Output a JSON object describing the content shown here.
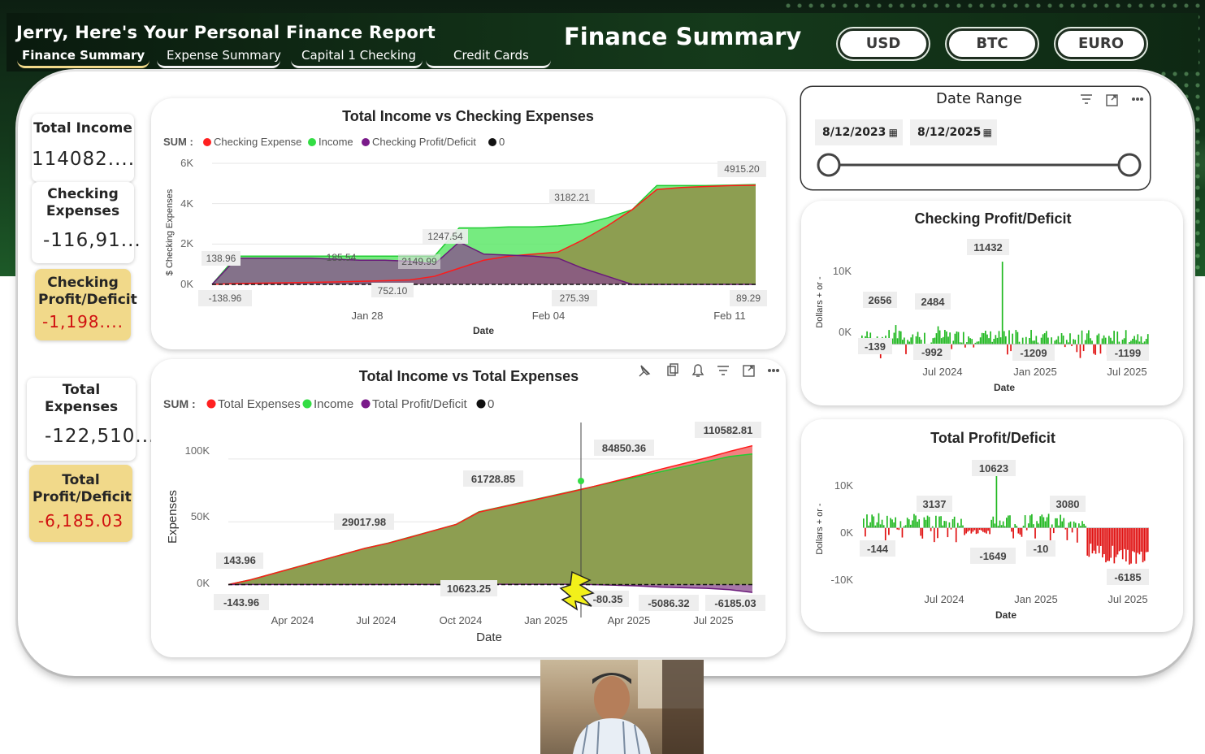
{
  "header": {
    "report_title": "Jerry, Here's Your Personal Finance Report",
    "page_title": "Finance Summary",
    "tabs": [
      {
        "label": "Finance Summary",
        "active": true
      },
      {
        "label": "Expense Summary",
        "active": false
      },
      {
        "label": "Capital 1 Checking",
        "active": false
      },
      {
        "label": "Credit Cards",
        "active": false
      }
    ],
    "currencies": [
      "USD",
      "BTC",
      "EURO"
    ]
  },
  "kpis": {
    "total_income": {
      "label": "Total Income",
      "value": "114082...."
    },
    "checking_expenses": {
      "label": "Checking Expenses",
      "value": "-116,91..."
    },
    "checking_profit": {
      "label": "Checking Profit/Deficit",
      "value": "-1,198...."
    },
    "total_expenses": {
      "label": "Total Expenses",
      "value": "-122,510..."
    },
    "total_profit": {
      "label": "Total Profit/Deficit",
      "value": "-6,185.03"
    }
  },
  "date_range": {
    "title": "Date Range",
    "start": "8/12/2023",
    "end": "8/12/2025"
  },
  "colors": {
    "expense_red": "#ff2020",
    "income_green": "#33dd44",
    "profit_purple": "#7a1a8a",
    "zero_black": "#111111",
    "gold": "#f1d98a",
    "neg_red": "#d01010"
  },
  "chart_data": [
    {
      "id": "checking",
      "type": "area",
      "title": "Total Income vs Checking Expenses",
      "legend_prefix": "SUM :",
      "legend": [
        "Checking Expense",
        "Income",
        "Checking Profit/Deficit",
        "0"
      ],
      "xlabel": "Date",
      "ylabel": "$ Checking Expenses",
      "yticks": [
        "6K",
        "4K",
        "2K",
        "0K"
      ],
      "xticks": [
        "Jan 28",
        "Feb 04",
        "Feb 11"
      ],
      "ylim": [
        0,
        6000
      ],
      "x": [
        0,
        1,
        2,
        3,
        4,
        5,
        6,
        7,
        8,
        9,
        10,
        11,
        12,
        13,
        14,
        15,
        16,
        17,
        18,
        19,
        20,
        21,
        22
      ],
      "series": [
        {
          "name": "Income",
          "values": [
            0,
            1400,
            1400,
            1400,
            1400,
            1400,
            1400,
            1400,
            1400,
            1400,
            2800,
            2800,
            2850,
            2850,
            2900,
            3000,
            3300,
            3700,
            4900,
            4900,
            4900,
            4920,
            4950
          ]
        },
        {
          "name": "Checking Expense",
          "values": [
            0,
            40,
            60,
            80,
            100,
            120,
            150,
            180,
            220,
            400,
            800,
            1200,
            1400,
            1500,
            1600,
            2200,
            2900,
            3700,
            4700,
            4800,
            4850,
            4900,
            4915
          ]
        },
        {
          "name": "Checking Profit/Deficit",
          "values": [
            0,
            1300,
            1300,
            1300,
            1300,
            1250,
            1200,
            1200,
            1150,
            1000,
            2100,
            1500,
            1450,
            1400,
            1300,
            800,
            400,
            0,
            0,
            0,
            0,
            0,
            0
          ]
        }
      ],
      "labels": [
        "138.96",
        "185.54",
        "2149.99",
        "1247.54",
        "3182.21",
        "4915.20",
        "-138.96",
        "752.10",
        "275.39",
        "89.29"
      ]
    },
    {
      "id": "total",
      "type": "area",
      "title": "Total Income vs Total Expenses",
      "legend_prefix": "SUM :",
      "legend": [
        "Total Expenses",
        "Income",
        "Total Profit/Deficit",
        "0"
      ],
      "xlabel": "Date",
      "ylabel": "Expenses",
      "yticks": [
        "100K",
        "50K",
        "0K"
      ],
      "xticks": [
        "Apr 2024",
        "Jul 2024",
        "Oct 2024",
        "Jan 2025",
        "Apr 2025",
        "Jul 2025"
      ],
      "ylim": [
        -10000,
        120000
      ],
      "x": [
        0,
        1,
        2,
        3,
        4,
        5,
        6,
        7,
        8,
        9,
        10,
        11,
        12,
        13,
        14,
        15,
        16,
        17,
        18,
        19,
        20,
        21,
        22,
        23
      ],
      "series": [
        {
          "name": "Income",
          "values": [
            0,
            4000,
            9000,
            14000,
            19000,
            24000,
            29000,
            33000,
            38000,
            43000,
            48000,
            58000,
            62000,
            66000,
            70000,
            74000,
            78000,
            82000,
            86000,
            90000,
            94000,
            98000,
            102000,
            104000
          ]
        },
        {
          "name": "Total Expenses",
          "values": [
            0,
            3900,
            8900,
            13900,
            18900,
            23900,
            28900,
            32900,
            37800,
            42900,
            47900,
            57700,
            61700,
            65700,
            69700,
            73700,
            78000,
            82500,
            87000,
            92000,
            96500,
            101000,
            106000,
            110582
          ]
        },
        {
          "name": "Total Profit/Deficit",
          "values": [
            0,
            100,
            100,
            100,
            100,
            100,
            100,
            100,
            200,
            100,
            100,
            300,
            300,
            300,
            300,
            300,
            0,
            -500,
            -1000,
            -2000,
            -2500,
            -3000,
            -4000,
            -6185
          ]
        }
      ],
      "labels": [
        "143.96",
        "29017.98",
        "61728.85",
        "84850.36",
        "110582.81",
        "-143.96",
        "10623.25",
        "-80.35",
        "-5086.32",
        "-6185.03"
      ]
    },
    {
      "id": "checking_pd",
      "type": "bar",
      "title": "Checking Profit/Deficit",
      "xlabel": "Date",
      "ylabel": "Dollars + or -",
      "yticks": [
        "10K",
        "0K"
      ],
      "xticks": [
        "Jul 2024",
        "Jan 2025",
        "Jul 2025"
      ],
      "ylim": [
        -1500,
        12000
      ],
      "labels": [
        "2656",
        "2484",
        "11432",
        "-139",
        "-992",
        "-1209",
        "-1199"
      ]
    },
    {
      "id": "total_pd",
      "type": "bar",
      "title": "Total Profit/Deficit",
      "xlabel": "Date",
      "ylabel": "Dollars + or -",
      "yticks": [
        "10K",
        "0K",
        "-10K"
      ],
      "xticks": [
        "Jul 2024",
        "Jan 2025",
        "Jul 2025"
      ],
      "ylim": [
        -10000,
        12000
      ],
      "labels": [
        "10623",
        "3137",
        "3080",
        "-144",
        "-1649",
        "-10",
        "-6185"
      ]
    }
  ]
}
